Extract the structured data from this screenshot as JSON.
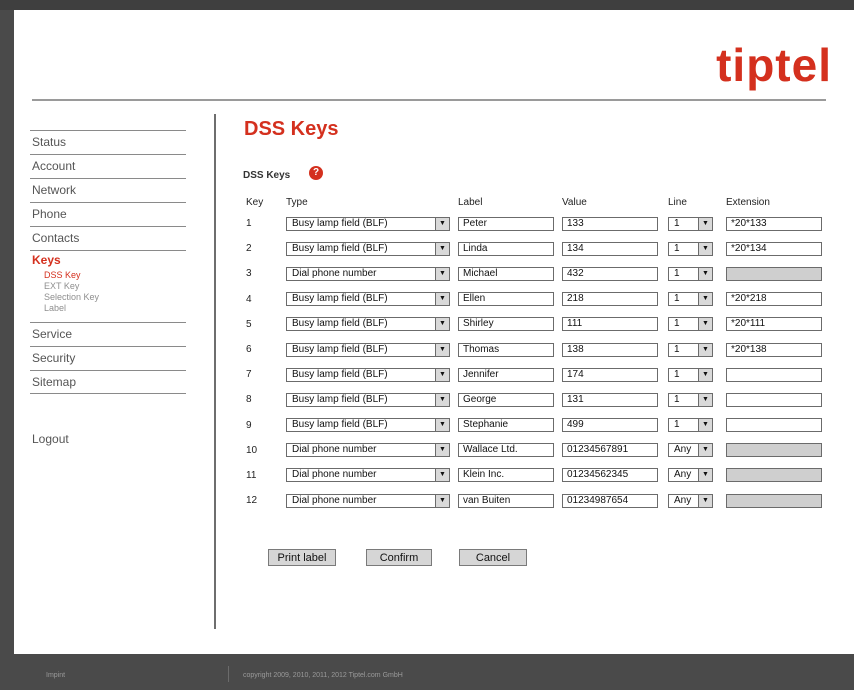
{
  "brand": {
    "logo": "tiptel",
    "color": "#d4301e"
  },
  "sidebar": {
    "items": [
      {
        "label": "Status"
      },
      {
        "label": "Account"
      },
      {
        "label": "Network"
      },
      {
        "label": "Phone"
      },
      {
        "label": "Contacts"
      },
      {
        "label": "Keys"
      },
      {
        "label": "Service"
      },
      {
        "label": "Security"
      },
      {
        "label": "Sitemap"
      }
    ],
    "sub_items": [
      "DSS Key",
      "EXT Key",
      "Selection Key",
      "Label"
    ],
    "logout": "Logout"
  },
  "main": {
    "title": "DSS Keys",
    "section_label": "DSS Keys",
    "help_icon": "question-icon",
    "columns": {
      "key": "Key",
      "type": "Type",
      "label": "Label",
      "value": "Value",
      "line": "Line",
      "extension": "Extension"
    },
    "rows": [
      {
        "key": "1",
        "type": "Busy lamp field (BLF)",
        "label": "Peter",
        "value": "133",
        "line": "1",
        "extension": "*20*133"
      },
      {
        "key": "2",
        "type": "Busy lamp field (BLF)",
        "label": "Linda",
        "value": "134",
        "line": "1",
        "extension": "*20*134"
      },
      {
        "key": "3",
        "type": "Dial phone number",
        "label": "Michael",
        "value": "432",
        "line": "1",
        "extension": ""
      },
      {
        "key": "4",
        "type": "Busy lamp field (BLF)",
        "label": "Ellen",
        "value": "218",
        "line": "1",
        "extension": "*20*218"
      },
      {
        "key": "5",
        "type": "Busy lamp field (BLF)",
        "label": "Shirley",
        "value": "111",
        "line": "1",
        "extension": "*20*111"
      },
      {
        "key": "6",
        "type": "Busy lamp field (BLF)",
        "label": "Thomas",
        "value": "138",
        "line": "1",
        "extension": "*20*138"
      },
      {
        "key": "7",
        "type": "Busy lamp field (BLF)",
        "label": "Jennifer",
        "value": "174",
        "line": "1",
        "extension": ""
      },
      {
        "key": "8",
        "type": "Busy lamp field (BLF)",
        "label": "George",
        "value": "131",
        "line": "1",
        "extension": ""
      },
      {
        "key": "9",
        "type": "Busy lamp field (BLF)",
        "label": "Stephanie",
        "value": "499",
        "line": "1",
        "extension": ""
      },
      {
        "key": "10",
        "type": "Dial phone number",
        "label": "Wallace Ltd.",
        "value": "01234567891",
        "line": "Any",
        "extension": ""
      },
      {
        "key": "11",
        "type": "Dial phone number",
        "label": "Klein Inc.",
        "value": "01234562345",
        "line": "Any",
        "extension": ""
      },
      {
        "key": "12",
        "type": "Dial phone number",
        "label": "van Buiten",
        "value": "01234987654",
        "line": "Any",
        "extension": ""
      }
    ],
    "buttons": {
      "print": "Print label",
      "confirm": "Confirm",
      "cancel": "Cancel"
    }
  },
  "footer": {
    "imprint": "Impint",
    "copyright": "copyright 2009, 2010, 2011, 2012 Tiptel.com GmbH"
  }
}
